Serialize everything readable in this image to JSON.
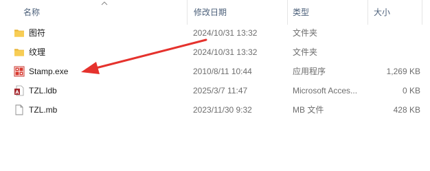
{
  "columns": {
    "name": "名称",
    "date_modified": "修改日期",
    "type": "类型",
    "size": "大小"
  },
  "files": [
    {
      "icon": "folder-icon",
      "name": "图符",
      "date": "2024/10/31 13:32",
      "type": "文件夹",
      "size": ""
    },
    {
      "icon": "folder-icon",
      "name": "纹理",
      "date": "2024/10/31 13:32",
      "type": "文件夹",
      "size": ""
    },
    {
      "icon": "app-exe-icon",
      "name": "Stamp.exe",
      "date": "2010/8/11 10:44",
      "type": "应用程序",
      "size": "1,269 KB"
    },
    {
      "icon": "access-ldb-icon",
      "name": "TZL.ldb",
      "date": "2025/3/7 11:47",
      "type": "Microsoft Acces...",
      "size": "0 KB"
    },
    {
      "icon": "blank-file-icon",
      "name": "TZL.mb",
      "date": "2023/11/30 9:32",
      "type": "MB 文件",
      "size": "428 KB"
    }
  ],
  "colors": {
    "header_text": "#4c607a",
    "secondary_text": "#6d6d6d",
    "folder": "#f4c542",
    "annotation_arrow": "#e5322d"
  }
}
